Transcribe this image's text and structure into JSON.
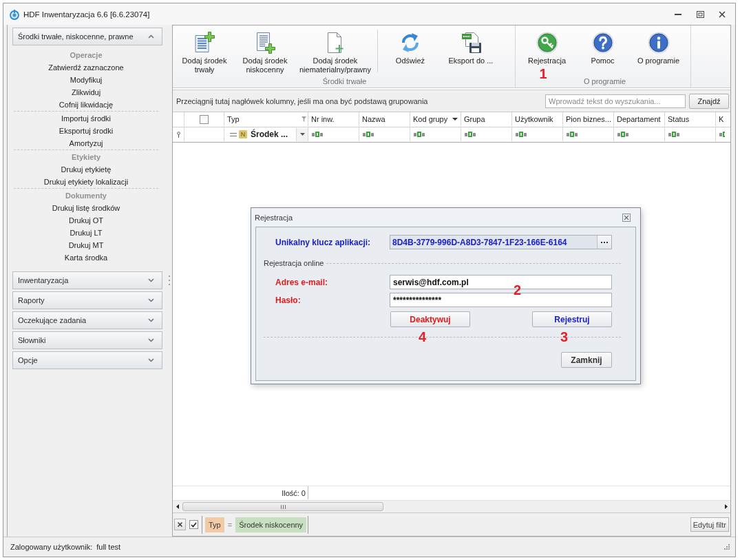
{
  "window": {
    "title": "HDF Inwentaryzacja 6.6 [6.6.23074]"
  },
  "sidebar": {
    "groups": [
      {
        "title": "Środki trwałe, niskocenne, prawne",
        "expanded": true,
        "sections": [
          {
            "heading": "Operacje",
            "items": [
              "Zatwierdź zaznaczone",
              "Modyfikuj",
              "Zlikwiduj",
              "Cofnij likwidację"
            ]
          },
          {
            "items": [
              "Importuj środki",
              "Eksportuj środki",
              "Amortyzuj"
            ]
          },
          {
            "heading": "Etykiety",
            "items": [
              "Drukuj etykietę",
              "Drukuj etykiety lokalizacji"
            ]
          },
          {
            "heading": "Dokumenty",
            "items": [
              "Drukuj listę środków",
              "Drukuj OT",
              "Drukuj LT",
              "Drukuj MT",
              "Karta środka"
            ]
          }
        ]
      },
      {
        "title": "Inwentaryzacja",
        "expanded": false
      },
      {
        "title": "Raporty",
        "expanded": false
      },
      {
        "title": "Oczekujące zadania",
        "expanded": false
      },
      {
        "title": "Słowniki",
        "expanded": false
      },
      {
        "title": "Opcje",
        "expanded": false
      }
    ]
  },
  "ribbon": {
    "groups": [
      {
        "label": "Środki trwałe",
        "clusters": [
          [
            {
              "label": "Dodaj środek\ntrwały"
            },
            {
              "label": "Dodaj środek\nniskocenny"
            },
            {
              "label": "Dodaj środek\nniematerialny/prawny"
            }
          ],
          [
            {
              "label": "Odśwież"
            },
            {
              "label": "Eksport do ..."
            }
          ]
        ]
      },
      {
        "label": "O programie",
        "clusters": [
          [
            {
              "label": "Rejestracja",
              "annotation": "1"
            },
            {
              "label": "Pomoc"
            },
            {
              "label": "O programie"
            }
          ]
        ]
      }
    ]
  },
  "grid": {
    "group_panel": {
      "hint": "Przeciągnij tutaj nagłówek kolumny, jeśli ma ona być podstawą grupowania",
      "search": {
        "placeholder": "Wprowadź tekst do wyszukania..."
      },
      "find_button": "Znajdź"
    },
    "columns": [
      {
        "kind": "check",
        "checked": false
      },
      {
        "kind": "text",
        "label": "Typ",
        "filtered": true,
        "sorted": false,
        "filter": {
          "kind": "value",
          "badge": "N",
          "value": "Środek ..."
        }
      },
      {
        "kind": "text",
        "label": "Nr inw.",
        "filtered": false,
        "sorted": false,
        "filter": {
          "kind": "contains"
        }
      },
      {
        "kind": "text",
        "label": "Nazwa",
        "filtered": false,
        "sorted": false,
        "filter": {
          "kind": "contains"
        }
      },
      {
        "kind": "text",
        "label": "Kod grupy",
        "filtered": false,
        "sorted": true,
        "filter": {
          "kind": "contains"
        }
      },
      {
        "kind": "text",
        "label": "Grupa",
        "filtered": false,
        "sorted": false,
        "filter": {
          "kind": "contains"
        }
      },
      {
        "kind": "text",
        "label": "Użytkownik",
        "filtered": false,
        "sorted": false,
        "filter": {
          "kind": "contains"
        }
      },
      {
        "kind": "text",
        "label": "Pion biznes...",
        "filtered": false,
        "sorted": false,
        "filter": {
          "kind": "contains"
        }
      },
      {
        "kind": "text",
        "label": "Departament",
        "filtered": false,
        "sorted": false,
        "filter": {
          "kind": "contains"
        }
      },
      {
        "kind": "text",
        "label": "Status",
        "filtered": false,
        "sorted": false,
        "filter": {
          "kind": "contains"
        }
      },
      {
        "kind": "text",
        "label": "K",
        "filtered": false,
        "sorted": false,
        "filter": {
          "kind": "contains"
        }
      }
    ],
    "footer": {
      "summary": "Ilość: 0"
    }
  },
  "filter_panel": {
    "enabled": true,
    "field": "Typ",
    "operator": "=",
    "value": "Środek niskocenny",
    "edit_button": "Edytuj filtr"
  },
  "status_bar": {
    "label": "Zalogowany użytkownik:",
    "user": "full test"
  },
  "dialog": {
    "title": "Rejestracja",
    "key": {
      "label": "Unikalny klucz aplikacji:",
      "value": "8D4B-3779-996D-A8D3-7847-1F23-166E-6164"
    },
    "section": "Rejestracja online",
    "annotation": "2",
    "fields": [
      {
        "label": "Adres e-mail:",
        "value": "serwis@hdf.com.pl"
      },
      {
        "label": "Hasło:",
        "value": "***************"
      }
    ],
    "actions": [
      {
        "label": "Deaktywuj",
        "kind": "danger",
        "annotation": "4"
      },
      {
        "label": "Rejestruj",
        "kind": "primary",
        "annotation": "3"
      }
    ],
    "close_button": "Zamknij"
  }
}
